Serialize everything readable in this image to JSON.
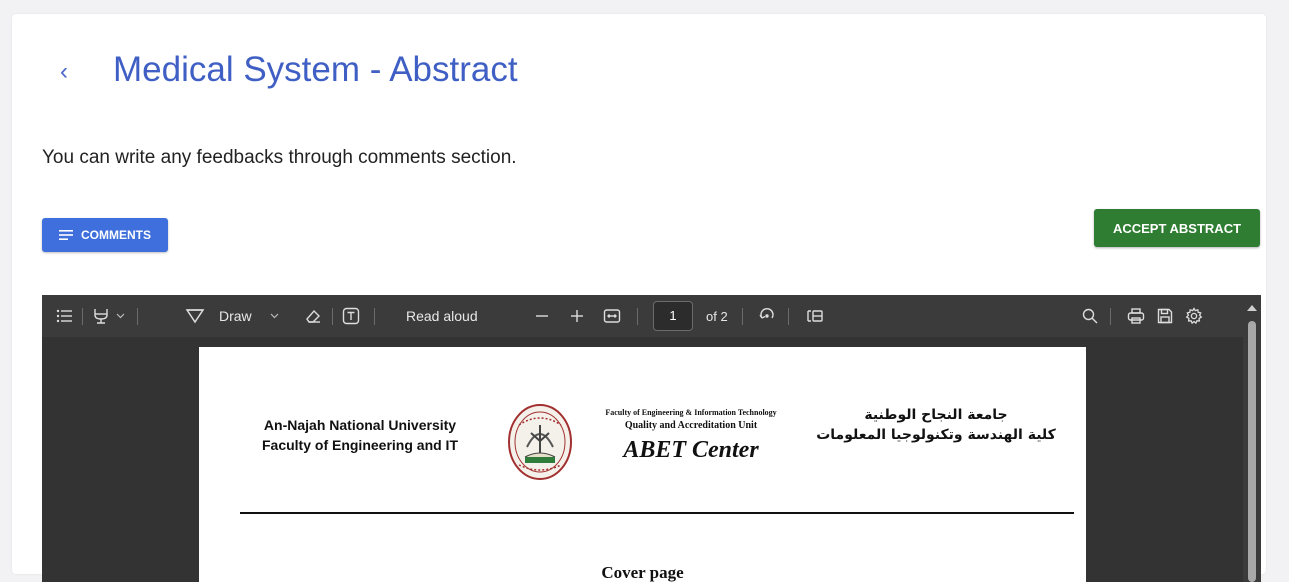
{
  "header": {
    "back_glyph": "‹",
    "title": "Medical System - Abstract",
    "subtitle": "You can write any feedbacks through comments section."
  },
  "actions": {
    "comments_label": "COMMENTS",
    "accept_label": "ACCEPT ABSTRACT",
    "comments_color": "#3f6fdc",
    "accept_color": "#2e7d32"
  },
  "pdf_toolbar": {
    "draw_label": "Draw",
    "read_aloud_label": "Read aloud",
    "current_page": "1",
    "page_count_label": "of 2",
    "icons": [
      "contents-icon",
      "highlight-icon",
      "draw-icon",
      "eraser-icon",
      "text-icon",
      "zoom-out-icon",
      "zoom-in-icon",
      "fit-width-icon",
      "rotate-icon",
      "page-view-icon",
      "search-icon",
      "print-icon",
      "save-icon",
      "settings-icon"
    ]
  },
  "document": {
    "uni_en_line1": "An-Najah National University",
    "uni_en_line2": "Faculty of Engineering and IT",
    "faculty_line1": "Faculty of Engineering & Information Technology",
    "faculty_line2": "Quality and Accreditation Unit",
    "center_name": "ABET Center",
    "uni_ar_line1": "جامعة النجاح الوطنية",
    "uni_ar_line2": "كلية الهندسة وتكنولوجيا المعلومات",
    "cover_heading": "Cover page"
  }
}
